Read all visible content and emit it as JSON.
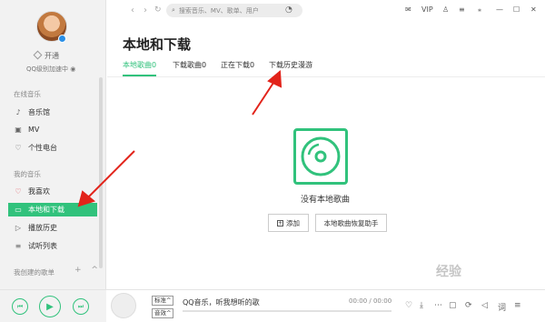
{
  "user": {
    "open_vip": "开通",
    "level_text": "QQ级别加速中"
  },
  "sidebar": {
    "online_title": "在线音乐",
    "online_items": [
      {
        "label": "音乐馆",
        "icon": "music-icon"
      },
      {
        "label": "MV",
        "icon": "mv-icon"
      },
      {
        "label": "个性电台",
        "icon": "radio-icon"
      }
    ],
    "my_music_title": "我的音乐",
    "my_items": [
      {
        "label": "我喜欢",
        "icon": "heart-icon"
      },
      {
        "label": "本地和下载",
        "icon": "monitor-icon"
      },
      {
        "label": "播放历史",
        "icon": "history-icon"
      },
      {
        "label": "试听列表",
        "icon": "list-icon"
      }
    ],
    "created_title": "我创建的歌单",
    "created_actions": "+ ^"
  },
  "topbar": {
    "search_placeholder": "搜索音乐、MV、歌单、用户",
    "vip": "VIP"
  },
  "main": {
    "title": "本地和下载",
    "tabs": [
      "本地歌曲0",
      "下载歌曲0",
      "正在下载0",
      "下载历史漫游"
    ],
    "active_tab": 0,
    "empty_text": "没有本地歌曲",
    "add_button": "添加",
    "restore_button": "本地歌曲恢复助手"
  },
  "player": {
    "quality_top": "标准",
    "quality_bottom": "音效",
    "song": "QQ音乐，听我想听的歌",
    "time": "00:00 / 00:00"
  },
  "watermark": "经验",
  "colors": {
    "accent": "#31c27c",
    "arrow": "#e2231a"
  }
}
